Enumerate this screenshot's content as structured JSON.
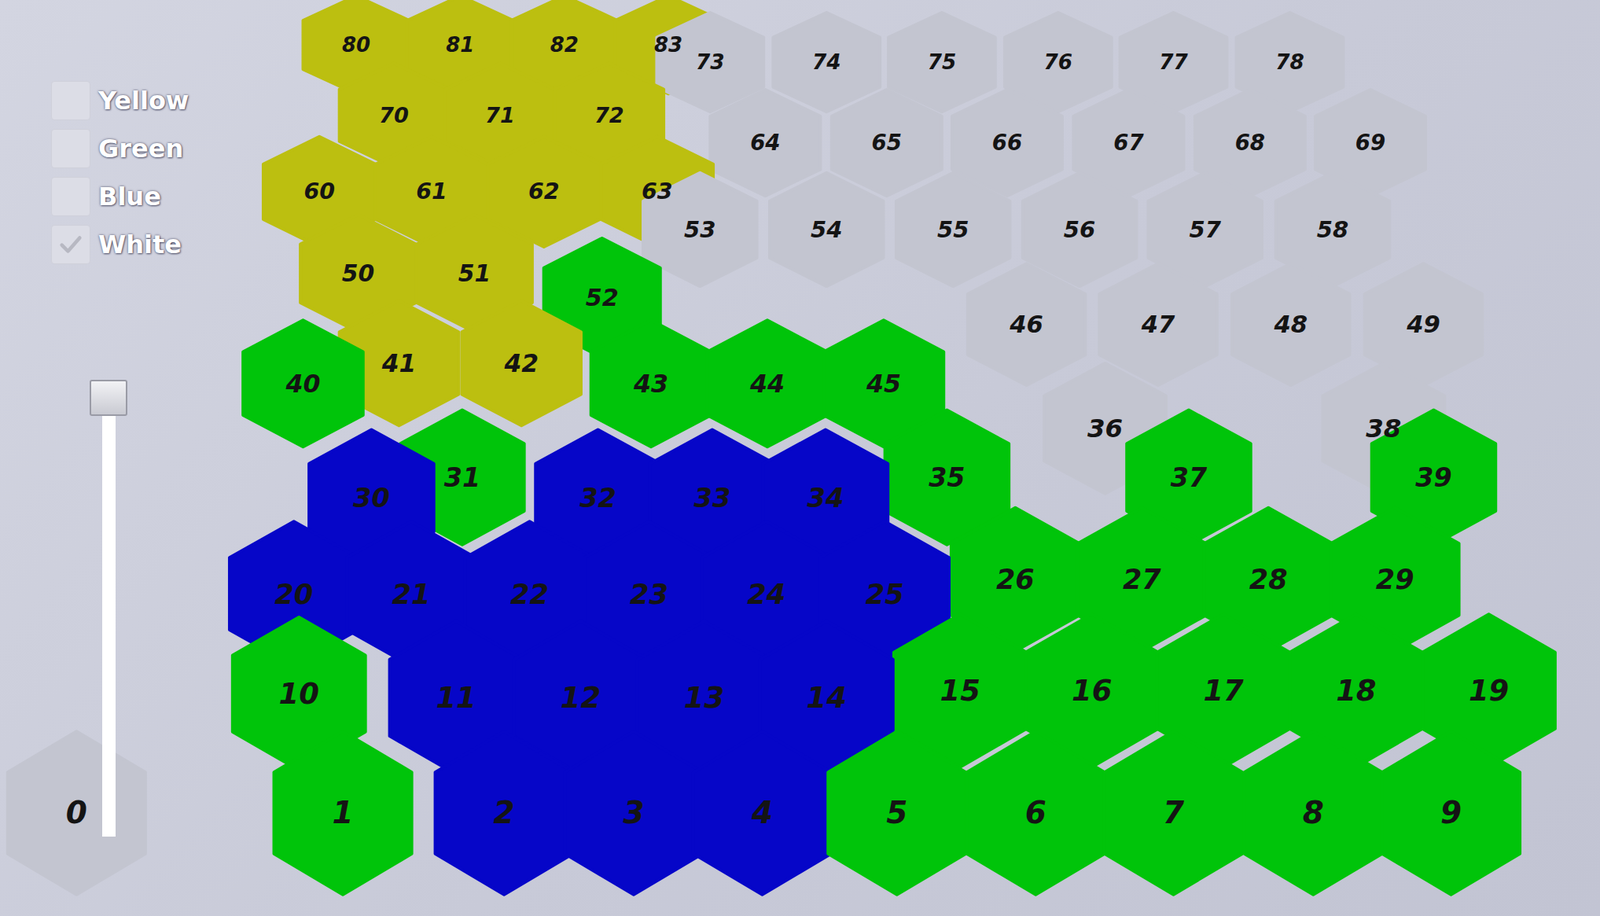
{
  "legend": [
    {
      "label": "Yellow",
      "checked": false
    },
    {
      "label": "Green",
      "checked": false
    },
    {
      "label": "Blue",
      "checked": false
    },
    {
      "label": "White",
      "checked": true
    }
  ],
  "slider": {
    "level": 1
  },
  "map": {
    "cells": [
      {
        "label": "0",
        "color": "#c3c5d0"
      },
      {
        "label": "1",
        "color": "#00c40a"
      },
      {
        "label": "2",
        "color": "#0606c8"
      },
      {
        "label": "3",
        "color": "#0606c8"
      },
      {
        "label": "4",
        "color": "#0606c8"
      },
      {
        "label": "5",
        "color": "#00c40a"
      },
      {
        "label": "6",
        "color": "#00c40a"
      },
      {
        "label": "7",
        "color": "#00c40a"
      },
      {
        "label": "8",
        "color": "#00c40a"
      },
      {
        "label": "9",
        "color": "#00c40a"
      },
      {
        "label": "10",
        "color": "#00c40a"
      },
      {
        "label": "11",
        "color": "#0606c8"
      },
      {
        "label": "12",
        "color": "#0606c8"
      },
      {
        "label": "13",
        "color": "#0606c8"
      },
      {
        "label": "14",
        "color": "#0606c8"
      },
      {
        "label": "15",
        "color": "#00c40a"
      },
      {
        "label": "16",
        "color": "#00c40a"
      },
      {
        "label": "17",
        "color": "#00c40a"
      },
      {
        "label": "18",
        "color": "#00c40a"
      },
      {
        "label": "19",
        "color": "#00c40a"
      },
      {
        "label": "20",
        "color": "#0606c8"
      },
      {
        "label": "21",
        "color": "#0606c8"
      },
      {
        "label": "22",
        "color": "#0606c8"
      },
      {
        "label": "23",
        "color": "#0606c8"
      },
      {
        "label": "24",
        "color": "#0606c8"
      },
      {
        "label": "25",
        "color": "#0606c8"
      },
      {
        "label": "26",
        "color": "#00c40a"
      },
      {
        "label": "27",
        "color": "#00c40a"
      },
      {
        "label": "28",
        "color": "#00c40a"
      },
      {
        "label": "29",
        "color": "#00c40a"
      },
      {
        "label": "30",
        "color": "#0606c8"
      },
      {
        "label": "31",
        "color": "#00c40a"
      },
      {
        "label": "32",
        "color": "#0606c8"
      },
      {
        "label": "33",
        "color": "#0606c8"
      },
      {
        "label": "34",
        "color": "#0606c8"
      },
      {
        "label": "35",
        "color": "#00c40a"
      },
      {
        "label": "36",
        "color": "#c3c5d0"
      },
      {
        "label": "37",
        "color": "#00c40a"
      },
      {
        "label": "38",
        "color": "#c3c5d0"
      },
      {
        "label": "39",
        "color": "#00c40a"
      },
      {
        "label": "40",
        "color": "#00c40a"
      },
      {
        "label": "41",
        "color": "#bcbf10"
      },
      {
        "label": "42",
        "color": "#bcbf10"
      },
      {
        "label": "43",
        "color": "#00c40a"
      },
      {
        "label": "44",
        "color": "#00c40a"
      },
      {
        "label": "45",
        "color": "#00c40a"
      },
      {
        "label": "46",
        "color": "#c3c5d0"
      },
      {
        "label": "47",
        "color": "#c3c5d0"
      },
      {
        "label": "48",
        "color": "#c3c5d0"
      },
      {
        "label": "49",
        "color": "#c3c5d0"
      },
      {
        "label": "50",
        "color": "#bcbf10"
      },
      {
        "label": "51",
        "color": "#bcbf10"
      },
      {
        "label": "52",
        "color": "#00c40a"
      },
      {
        "label": "53",
        "color": "#c3c5d0"
      },
      {
        "label": "54",
        "color": "#c3c5d0"
      },
      {
        "label": "55",
        "color": "#c3c5d0"
      },
      {
        "label": "56",
        "color": "#c3c5d0"
      },
      {
        "label": "57",
        "color": "#c3c5d0"
      },
      {
        "label": "58",
        "color": "#c3c5d0"
      },
      {
        "label": "60",
        "color": "#bcbf10"
      },
      {
        "label": "61",
        "color": "#bcbf10"
      },
      {
        "label": "62",
        "color": "#bcbf10"
      },
      {
        "label": "63",
        "color": "#bcbf10"
      },
      {
        "label": "64",
        "color": "#c3c5d0"
      },
      {
        "label": "65",
        "color": "#c3c5d0"
      },
      {
        "label": "66",
        "color": "#c3c5d0"
      },
      {
        "label": "67",
        "color": "#c3c5d0"
      },
      {
        "label": "68",
        "color": "#c3c5d0"
      },
      {
        "label": "69",
        "color": "#c3c5d0"
      },
      {
        "label": "70",
        "color": "#bcbf10"
      },
      {
        "label": "71",
        "color": "#bcbf10"
      },
      {
        "label": "72",
        "color": "#bcbf10"
      },
      {
        "label": "73",
        "color": "#c3c5d0"
      },
      {
        "label": "74",
        "color": "#c3c5d0"
      },
      {
        "label": "75",
        "color": "#c3c5d0"
      },
      {
        "label": "76",
        "color": "#c3c5d0"
      },
      {
        "label": "77",
        "color": "#c3c5d0"
      },
      {
        "label": "78",
        "color": "#c3c5d0"
      },
      {
        "label": "80",
        "color": "#bcbf10"
      },
      {
        "label": "81",
        "color": "#bcbf10"
      },
      {
        "label": "82",
        "color": "#bcbf10"
      },
      {
        "label": "83",
        "color": "#bcbf10"
      }
    ]
  }
}
